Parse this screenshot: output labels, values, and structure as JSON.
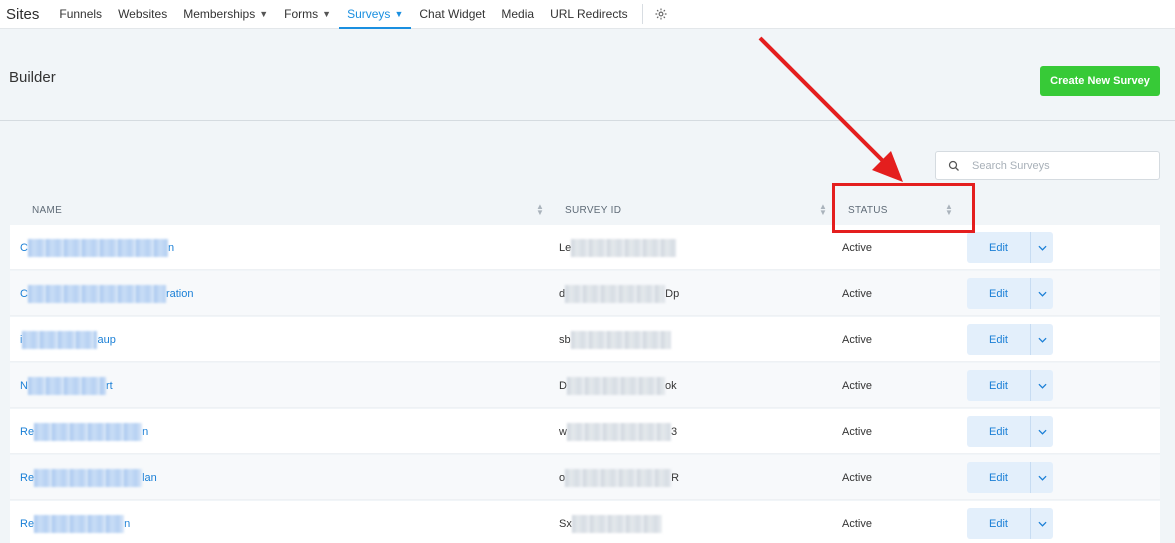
{
  "topnav": {
    "brand": "Sites",
    "items": [
      {
        "label": "Funnels"
      },
      {
        "label": "Websites"
      },
      {
        "label": "Memberships"
      },
      {
        "label": "Forms"
      },
      {
        "label": "Surveys"
      },
      {
        "label": "Chat Widget"
      },
      {
        "label": "Media"
      },
      {
        "label": "URL Redirects"
      }
    ],
    "active": "Surveys"
  },
  "header": {
    "title": "Builder",
    "create_button": "Create New Survey"
  },
  "search": {
    "placeholder": "Search Surveys",
    "value": ""
  },
  "table": {
    "columns": [
      "NAME",
      "SURVEY ID",
      "STATUS"
    ],
    "rows": [
      {
        "name_prefix": "C",
        "name_suffix": "n",
        "id_prefix": "Le",
        "id_suffix": "",
        "status": "Active"
      },
      {
        "name_prefix": "C",
        "name_suffix": "ration",
        "id_prefix": "d",
        "id_suffix": "Dp",
        "status": "Active"
      },
      {
        "name_prefix": "i",
        "name_suffix": "aup",
        "id_prefix": "sb",
        "id_suffix": "",
        "status": "Active"
      },
      {
        "name_prefix": "N",
        "name_suffix": "rt",
        "id_prefix": "D",
        "id_suffix": "ok",
        "status": "Active"
      },
      {
        "name_prefix": "Re",
        "name_suffix": "n",
        "id_prefix": "w",
        "id_suffix": "3",
        "status": "Active"
      },
      {
        "name_prefix": "Re",
        "name_suffix": "lan",
        "id_prefix": "o",
        "id_suffix": "R",
        "status": "Active"
      },
      {
        "name_prefix": "Re",
        "name_suffix": "n",
        "id_prefix": "Sx",
        "id_suffix": "",
        "status": "Active"
      }
    ],
    "edit_label": "Edit"
  },
  "colors": {
    "accent": "#1a8fe0",
    "create_button": "#37ca37",
    "annotation": "#e41e1e"
  },
  "icons": {
    "settings": "gear-icon",
    "search": "search-icon",
    "sort": "sort-icon",
    "dropdown": "chevron-down-icon"
  }
}
